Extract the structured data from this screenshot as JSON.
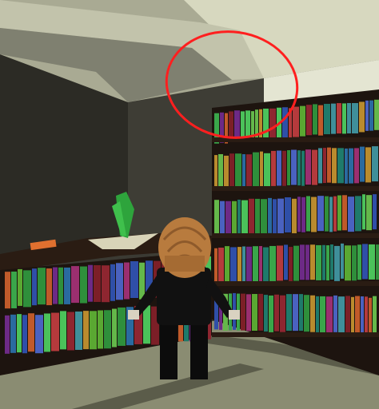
{
  "scene": {
    "colors": {
      "ceiling_light": "#d7d8bf",
      "ceiling_mid": "#a9aa93",
      "beam_top": "#c2c3ab",
      "beam_side": "#7f8070",
      "wall_back": "#3b3a33",
      "wall_left": "#2c2b25",
      "shelf_frame": "#1d140f",
      "shelf_wood": "#2a1c13",
      "floor": "#8a8c72",
      "floor_dark": "#5b5c4a",
      "annotation": "#ff1f1f",
      "avatar_hair": "#b87b3e",
      "avatar_body": "#0c0c0c",
      "plant": "#2ea43c",
      "book_cover": "#e0702f"
    },
    "book_palette": [
      "#2f8f3b",
      "#3aa64a",
      "#4bc25a",
      "#8e2630",
      "#b53a3c",
      "#2f4fa8",
      "#4a62c0",
      "#1f7a6b",
      "#6d2a86",
      "#b98b2e",
      "#c05a2a",
      "#2a6aa0",
      "#5aa832",
      "#7c1f27",
      "#3f8f9a",
      "#9b2f70",
      "#64b84a"
    ]
  }
}
